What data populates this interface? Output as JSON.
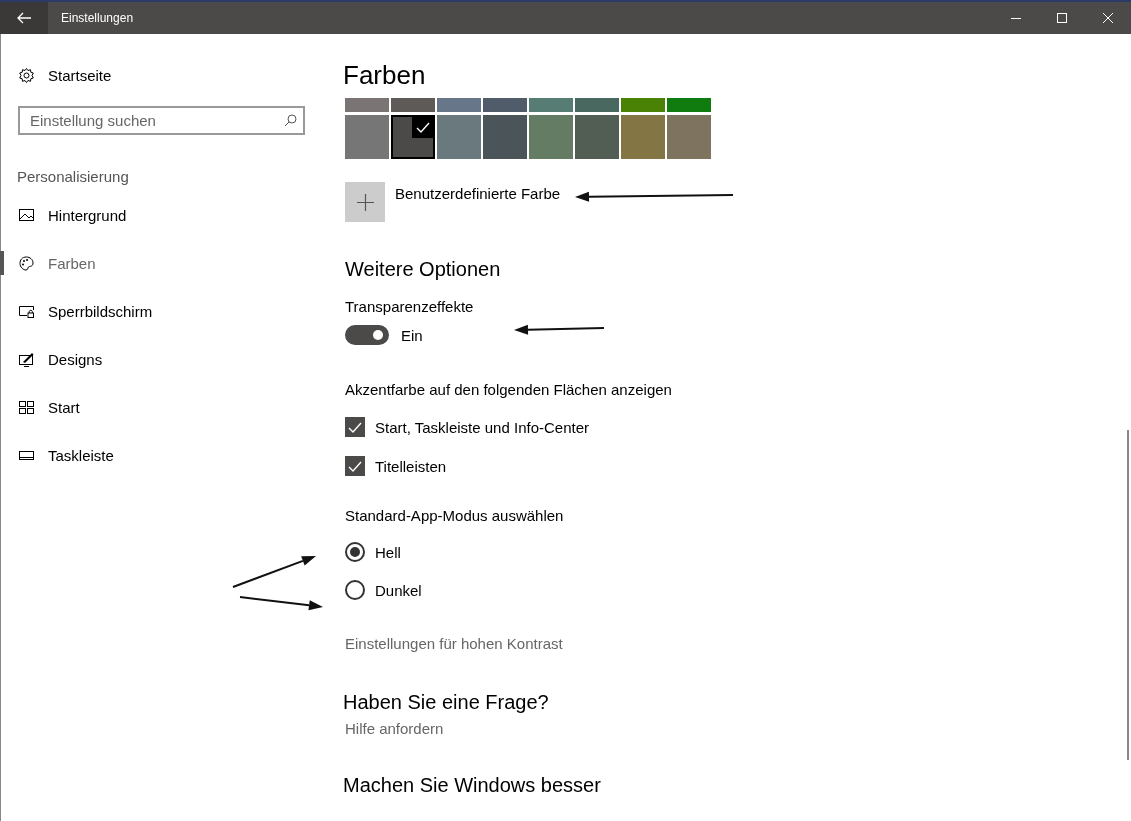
{
  "window": {
    "title": "Einstellungen"
  },
  "sidebar": {
    "home": "Startseite",
    "search": {
      "placeholder": "Einstellung suchen"
    },
    "section": "Personalisierung",
    "items": [
      {
        "label": "Hintergrund",
        "kind": "picture",
        "selected": false
      },
      {
        "label": "Farben",
        "kind": "palette",
        "selected": true
      },
      {
        "label": "Sperrbildschirm",
        "kind": "lock",
        "selected": false
      },
      {
        "label": "Designs",
        "kind": "design",
        "selected": false
      },
      {
        "label": "Start",
        "kind": "tiles",
        "selected": false
      },
      {
        "label": "Taskleiste",
        "kind": "taskbar",
        "selected": false
      }
    ]
  },
  "content": {
    "heading": "Farben",
    "swatch_rows": [
      {
        "swatches": [
          {
            "color": "#7a7574",
            "selected": false
          },
          {
            "color": "#5d5a58",
            "selected": false
          },
          {
            "color": "#68768a",
            "selected": false
          },
          {
            "color": "#515c6b",
            "selected": false
          },
          {
            "color": "#567c73",
            "selected": false
          },
          {
            "color": "#486860",
            "selected": false
          },
          {
            "color": "#498205",
            "selected": false
          },
          {
            "color": "#107c10",
            "selected": false
          }
        ]
      },
      {
        "swatches": [
          {
            "color": "#767676",
            "selected": false
          },
          {
            "color": "#4c4a48",
            "selected": true
          },
          {
            "color": "#69797e",
            "selected": false
          },
          {
            "color": "#4a5459",
            "selected": false
          },
          {
            "color": "#647c64",
            "selected": false
          },
          {
            "color": "#525e54",
            "selected": false
          },
          {
            "color": "#847545",
            "selected": false
          },
          {
            "color": "#7e735f",
            "selected": false
          }
        ]
      }
    ],
    "custom_color": {
      "label": "Benutzerdefinierte Farbe"
    },
    "more_options": {
      "heading": "Weitere Optionen"
    },
    "transparency": {
      "label": "Transparenzeffekte",
      "on": true,
      "state_text": "Ein"
    },
    "accent_surfaces": {
      "label": "Akzentfarbe auf den folgenden Flächen anzeigen",
      "options": [
        {
          "label": "Start, Taskleiste und Info-Center",
          "checked": true
        },
        {
          "label": "Titelleisten",
          "checked": true
        }
      ]
    },
    "app_mode": {
      "label": "Standard-App-Modus auswählen",
      "options": [
        {
          "label": "Hell",
          "selected": true
        },
        {
          "label": "Dunkel",
          "selected": false
        }
      ]
    },
    "contrast_link": "Einstellungen für hohen Kontrast",
    "help": {
      "heading": "Haben Sie eine Frage?",
      "link": "Hilfe anfordern"
    },
    "feedback": {
      "heading": "Machen Sie Windows besser"
    }
  }
}
